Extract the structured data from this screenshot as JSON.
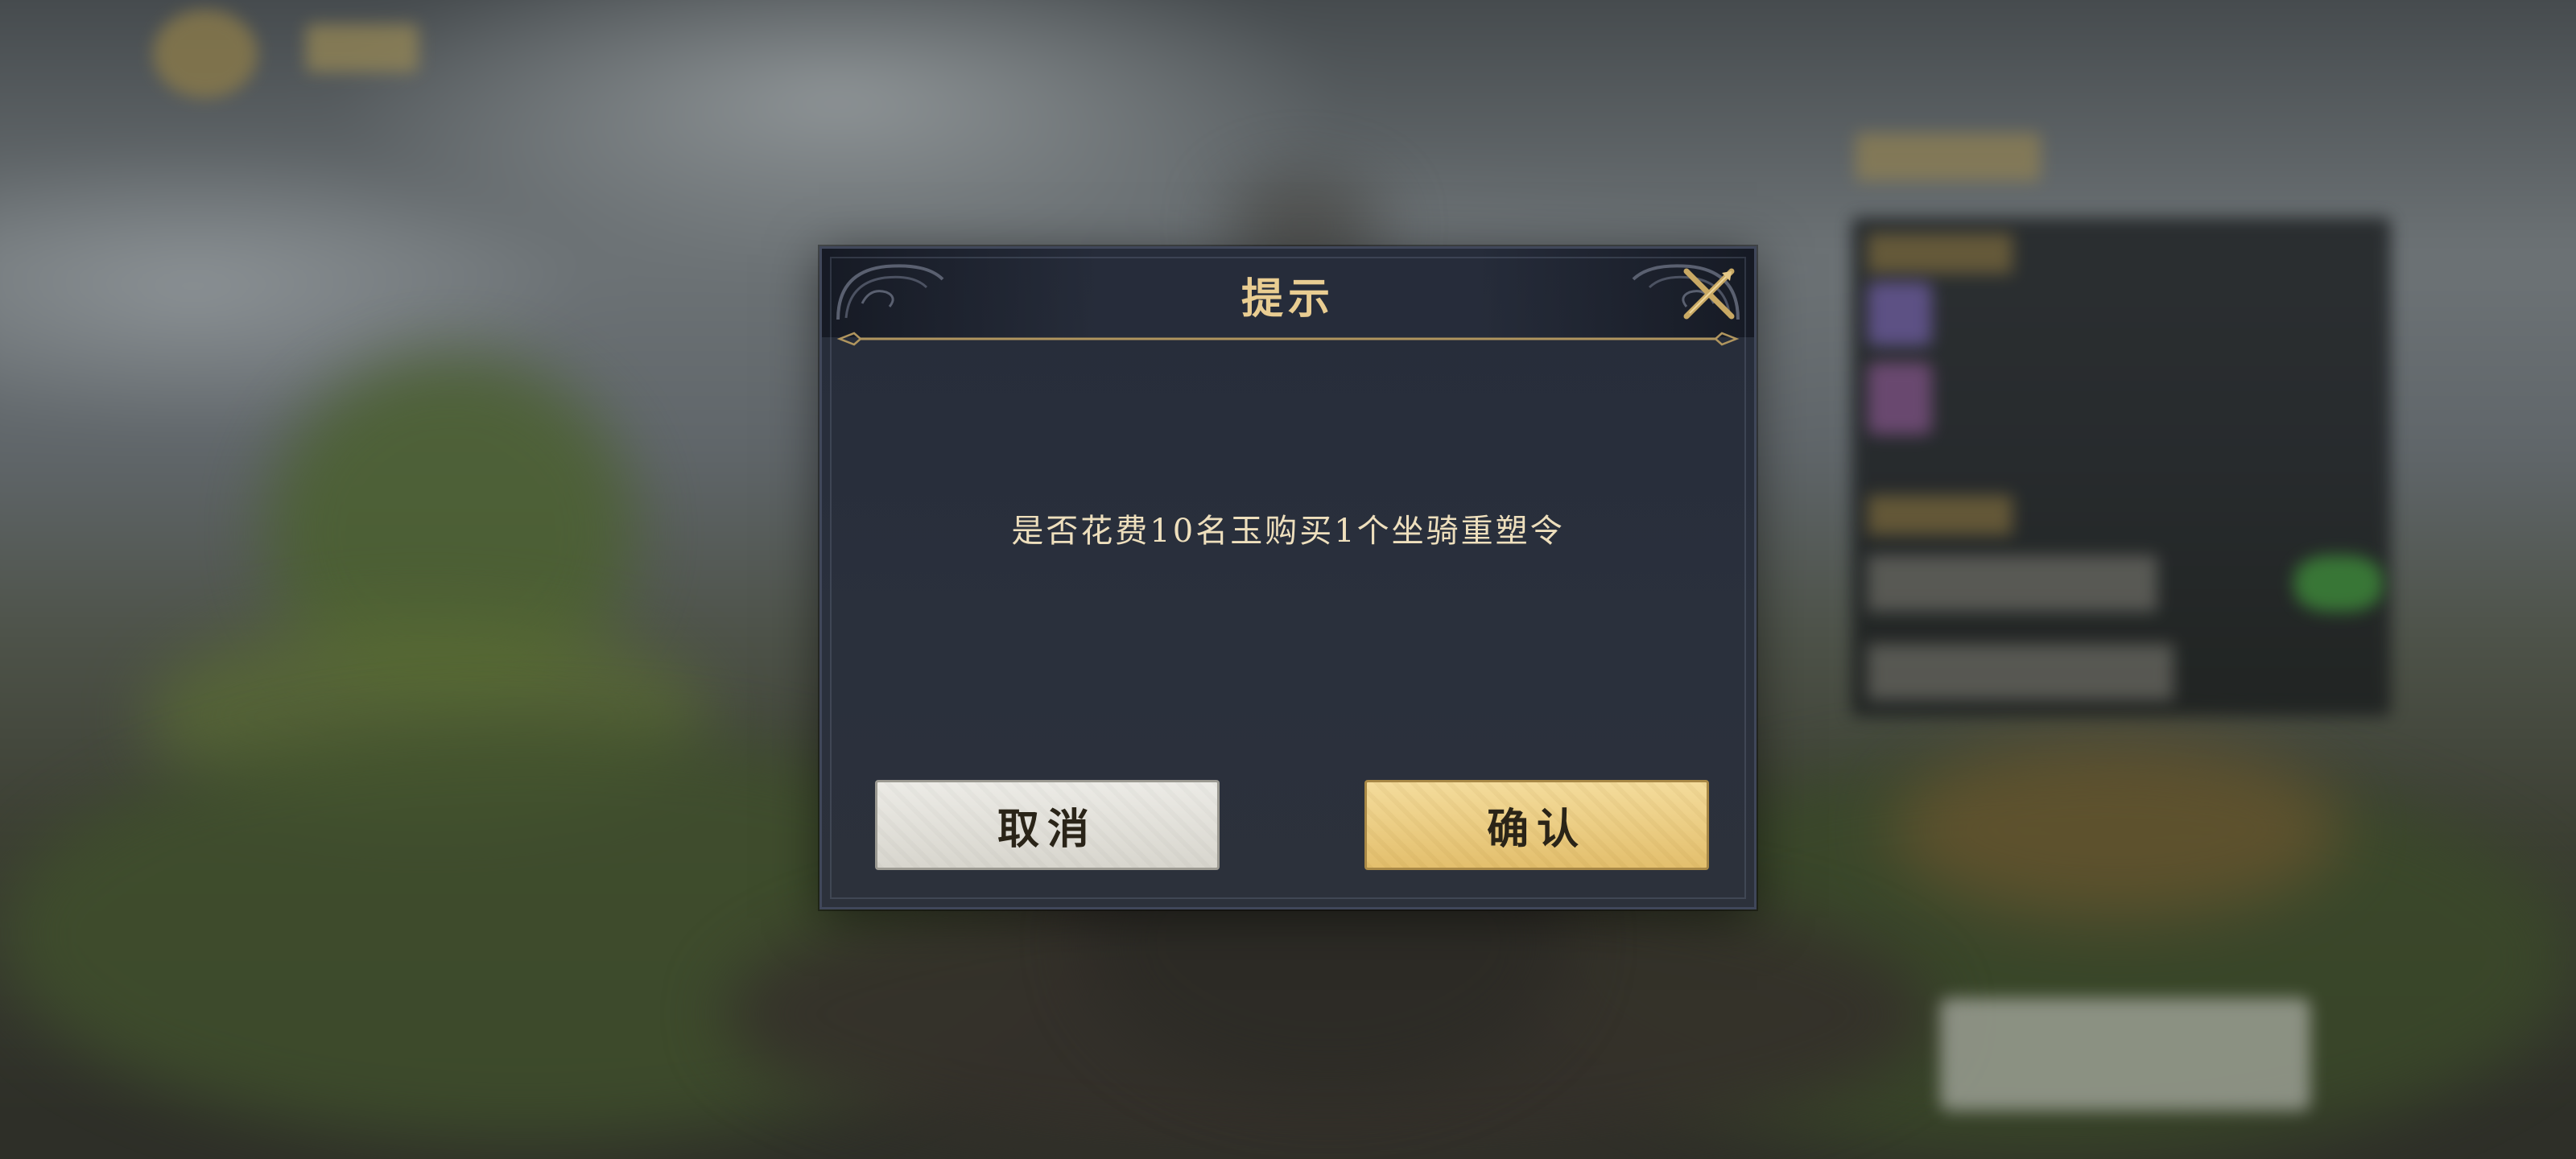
{
  "dialog": {
    "title": "提示",
    "message": "是否花费10名玉购买1个坐骑重塑令",
    "close_icon": "close-icon",
    "buttons": {
      "cancel_label": "取消",
      "confirm_label": "确认"
    }
  },
  "colors": {
    "dialog_bg": "#262c3a",
    "title_gold": "#e9cd92",
    "message_text": "#eedfbd",
    "cancel_button": "#e2e1da",
    "confirm_button": "#ecca7e"
  }
}
